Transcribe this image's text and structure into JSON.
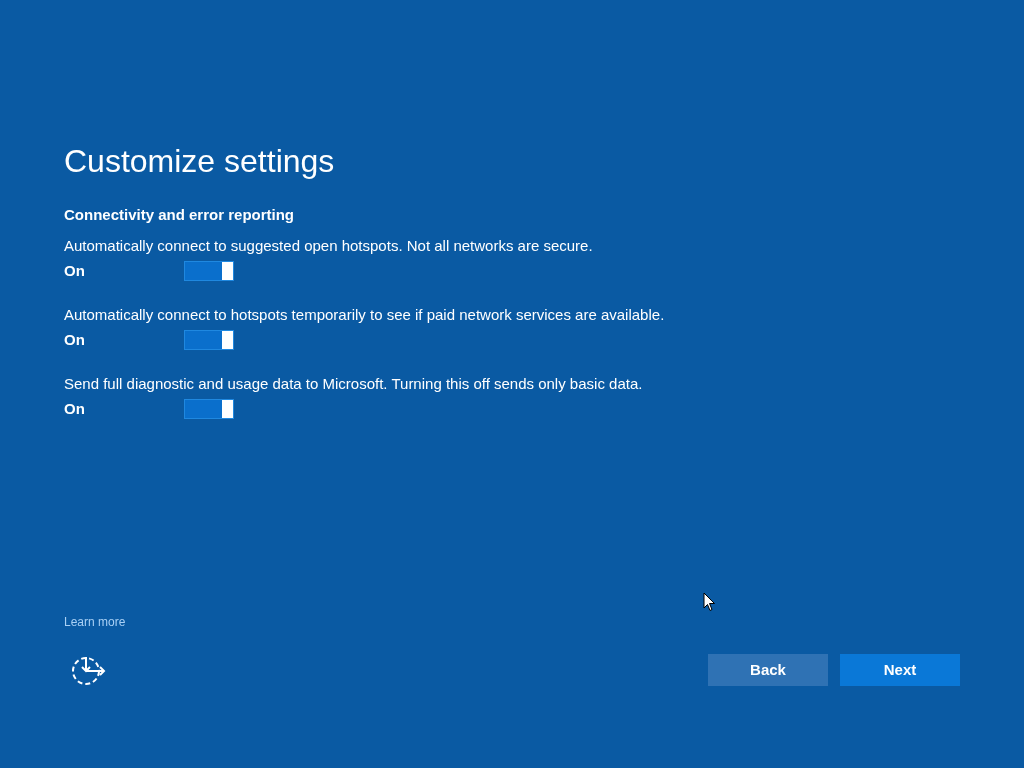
{
  "title": "Customize settings",
  "section": {
    "heading": "Connectivity and error reporting",
    "settings": [
      {
        "description": "Automatically connect to suggested open hotspots. Not all networks are secure.",
        "state_label": "On",
        "on": true
      },
      {
        "description": "Automatically connect to hotspots temporarily to see if paid network services are available.",
        "state_label": "On",
        "on": true
      },
      {
        "description": "Send full diagnostic and usage data to Microsoft. Turning this off sends only basic data.",
        "state_label": "On",
        "on": true
      }
    ]
  },
  "learn_more": "Learn more",
  "buttons": [
    {
      "label": "Back",
      "kind": "secondary"
    },
    {
      "label": "Next",
      "kind": "primary"
    }
  ]
}
